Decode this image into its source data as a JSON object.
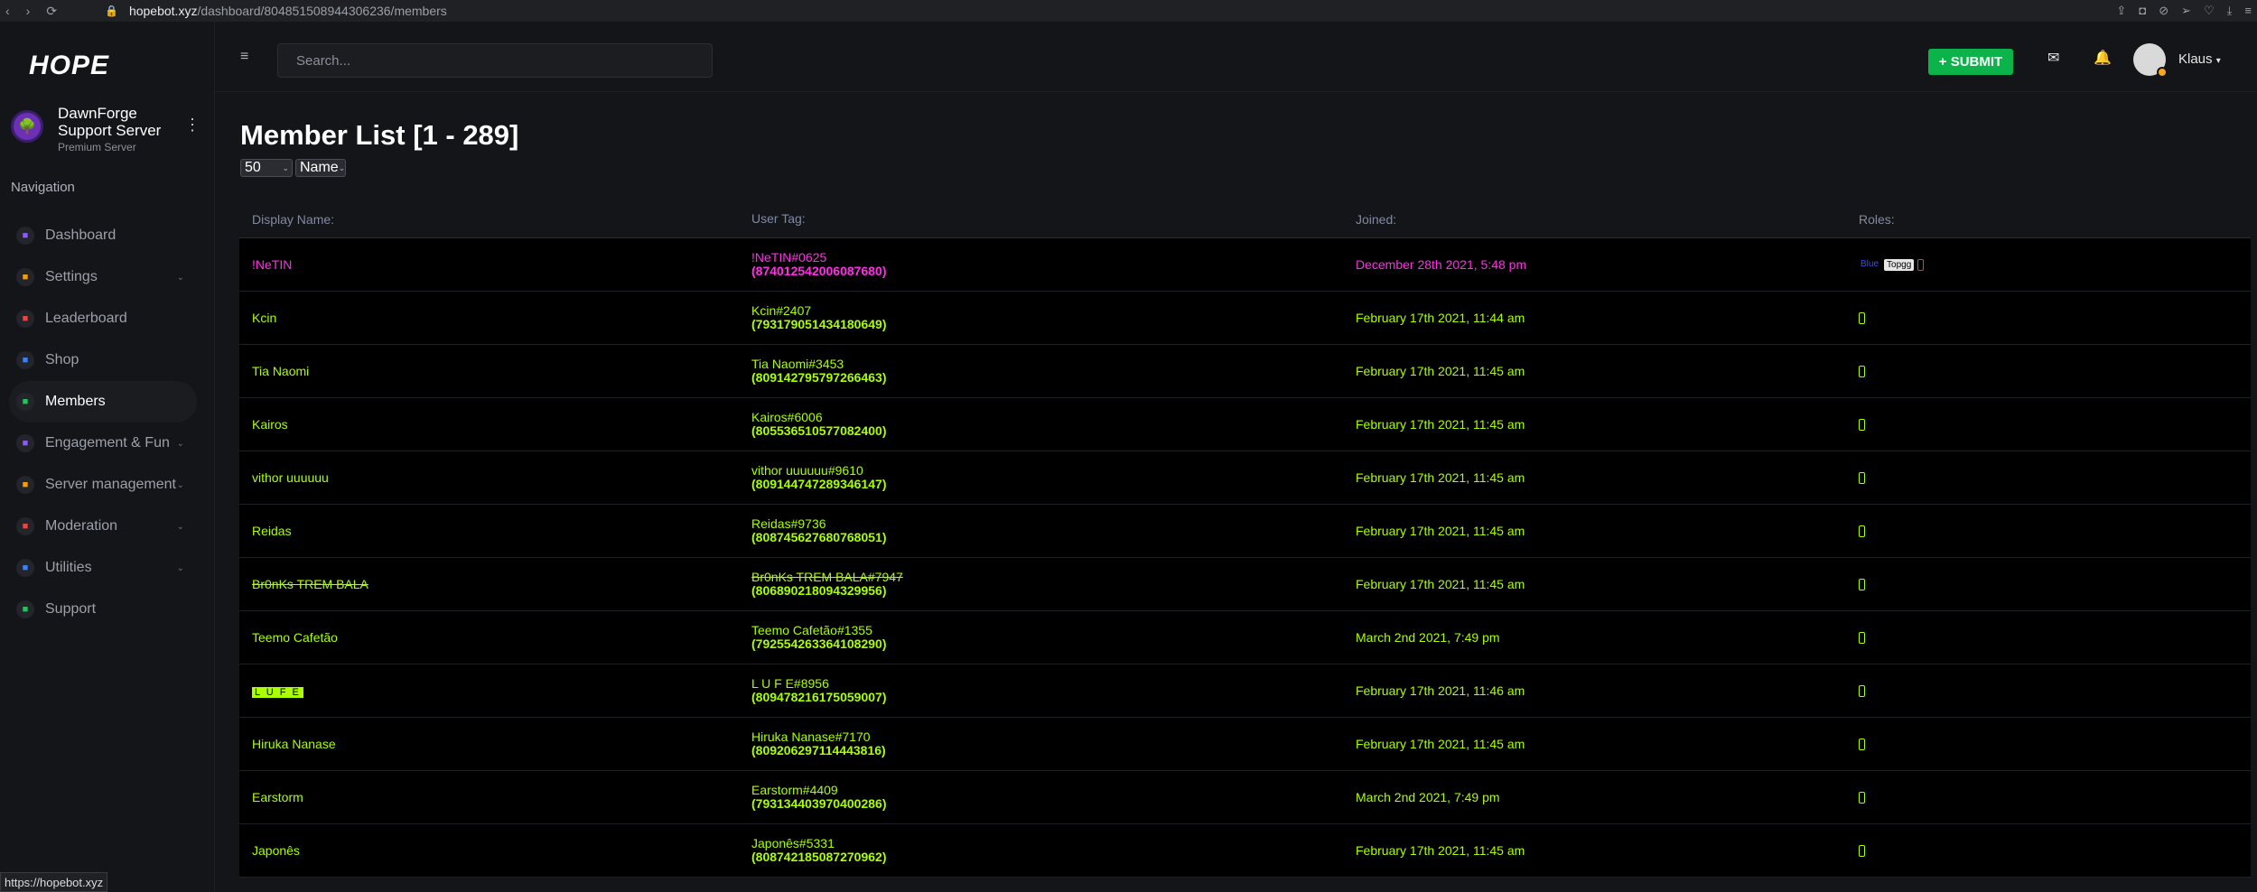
{
  "browser": {
    "url_host": "hopebot.xyz",
    "url_path": "/dashboard/804851508944306236/members",
    "status_url": "https://hopebot.xyz"
  },
  "brand": {
    "logo_text": "HOPE"
  },
  "server": {
    "name": "DawnForge Support Server",
    "tier": "Premium Server"
  },
  "sidebar": {
    "heading": "Navigation",
    "items": [
      {
        "label": "Dashboard",
        "icon": "grid-icon",
        "color": "#8b5cf6",
        "expandable": false
      },
      {
        "label": "Settings",
        "icon": "gear-icon",
        "color": "#f59e0b",
        "expandable": true
      },
      {
        "label": "Leaderboard",
        "icon": "trophy-icon",
        "color": "#ef4444",
        "expandable": false
      },
      {
        "label": "Shop",
        "icon": "bag-icon",
        "color": "#3b82f6",
        "expandable": false
      },
      {
        "label": "Members",
        "icon": "users-icon",
        "color": "#22c55e",
        "expandable": false,
        "active": true
      },
      {
        "label": "Engagement & Fun",
        "icon": "chat-icon",
        "color": "#8b5cf6",
        "expandable": true
      },
      {
        "label": "Server management",
        "icon": "server-icon",
        "color": "#f59e0b",
        "expandable": true
      },
      {
        "label": "Moderation",
        "icon": "shield-icon",
        "color": "#ef4444",
        "expandable": true
      },
      {
        "label": "Utilities",
        "icon": "cog-icon",
        "color": "#3b82f6",
        "expandable": true
      },
      {
        "label": "Support",
        "icon": "question-icon",
        "color": "#22c55e",
        "expandable": false
      }
    ]
  },
  "topbar": {
    "search_placeholder": "Search...",
    "submit_label": "+ SUBMIT",
    "username": "Klaus"
  },
  "page": {
    "title": "Member List [1 - 289]",
    "page_size": "50",
    "sort_by": "Name"
  },
  "table": {
    "headers": [
      "Display Name:",
      "User Tag:",
      "Joined:",
      "Roles:"
    ],
    "rows": [
      {
        "name": "!NeTIN",
        "tag": "!NeTIN#0625",
        "id": "(874012542006087680)",
        "joined": "December 28th 2021, 5:48 pm",
        "color": "pink",
        "roles": [
          "Blue",
          "Topgg",
          ""
        ]
      },
      {
        "name": "Kcin",
        "tag": "Kcin#2407",
        "id": "(793179051434180649)",
        "joined": "February 17th 2021, 11:44 am",
        "roles": [
          ""
        ]
      },
      {
        "name": "Tia Naomi",
        "tag": "Tia Naomi#3453",
        "id": "(809142795797266463)",
        "joined": "February 17th 2021, 11:45 am",
        "roles": [
          ""
        ]
      },
      {
        "name": "Kairos",
        "tag": "Kairos#6006",
        "id": "(805536510577082400)",
        "joined": "February 17th 2021, 11:45 am",
        "roles": [
          ""
        ]
      },
      {
        "name": "vithor uuuuuu",
        "tag": "vithor uuuuuu#9610",
        "id": "(809144747289346147)",
        "joined": "February 17th 2021, 11:45 am",
        "roles": [
          ""
        ]
      },
      {
        "name": "Reidas",
        "tag": "Reidas#9736",
        "id": "(808745627680768051)",
        "joined": "February 17th 2021, 11:45 am",
        "roles": [
          ""
        ]
      },
      {
        "name": "Br0nKs TREM BALA",
        "tag": "Br0nKs TREM BALA#7947",
        "id": "(806890218094329956)",
        "joined": "February 17th 2021, 11:45 am",
        "style": "strike",
        "roles": [
          ""
        ]
      },
      {
        "name": "Teemo Cafetão",
        "tag": "Teemo Cafetão#1355",
        "id": "(792554263364108290)",
        "joined": "March 2nd 2021, 7:49 pm",
        "roles": [
          ""
        ]
      },
      {
        "name": "L U F E",
        "tag": "L U F E#8956",
        "id": "(809478216175059007)",
        "joined": "February 17th 2021, 11:46 am",
        "style": "highlight",
        "roles": [
          ""
        ]
      },
      {
        "name": "Hiruka Nanase",
        "tag": "Hiruka Nanase#7170",
        "id": "(809206297114443816)",
        "joined": "February 17th 2021, 11:45 am",
        "roles": [
          ""
        ]
      },
      {
        "name": "Earstorm",
        "tag": "Earstorm#4409",
        "id": "(793134403970400286)",
        "joined": "March 2nd 2021, 7:49 pm",
        "roles": [
          ""
        ]
      },
      {
        "name": "Japonês",
        "tag": "Japonês#5331",
        "id": "(808742185087270962)",
        "joined": "February 17th 2021, 11:45 am",
        "roles": [
          ""
        ]
      }
    ]
  }
}
